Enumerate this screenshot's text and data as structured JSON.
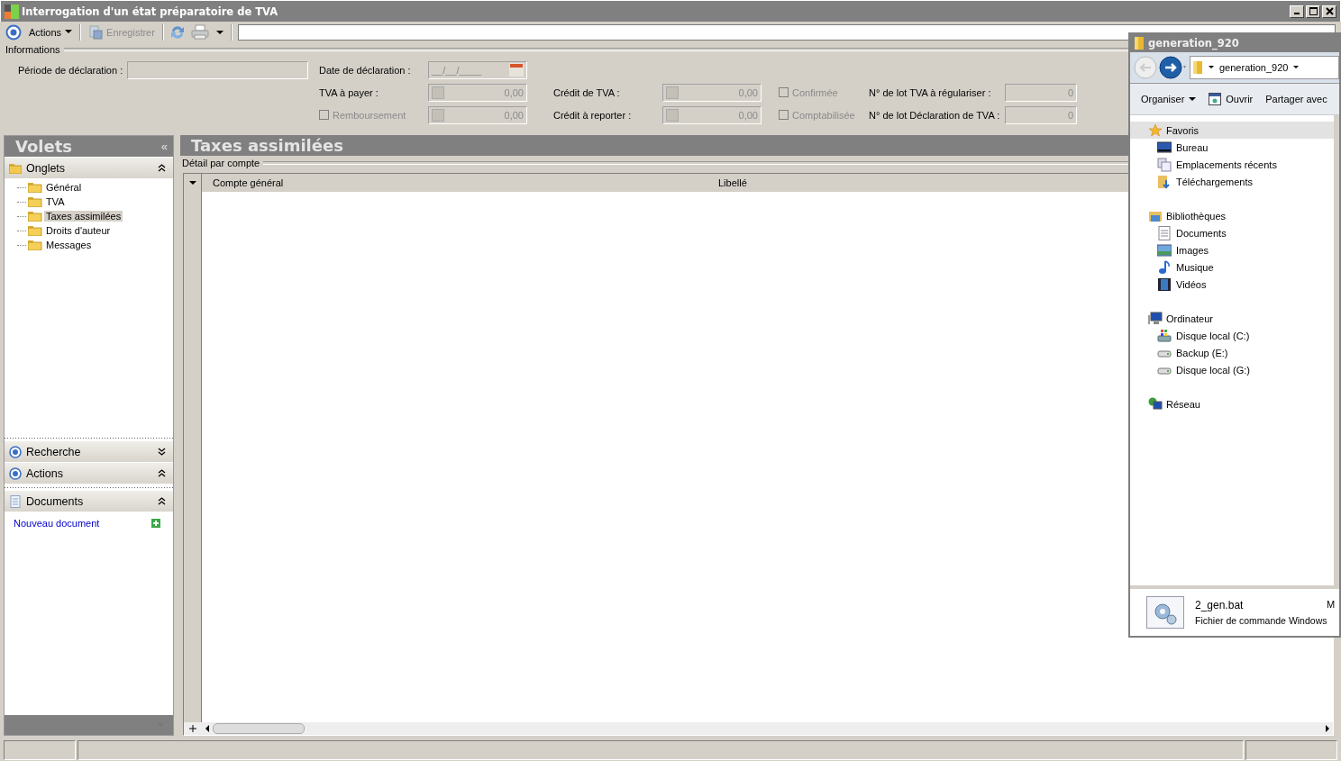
{
  "window": {
    "title": "Interrogation d'un état préparatoire de TVA"
  },
  "toolbar": {
    "actions": "Actions",
    "save": {
      "label": "Enregistrer",
      "disabled": true
    }
  },
  "informations": {
    "legend": "Informations",
    "periode": {
      "label": "Période de déclaration :"
    },
    "date": {
      "label": "Date de déclaration :",
      "value": "__/__/____"
    },
    "tva_a_payer": {
      "label": "TVA à payer :",
      "value": "0,00"
    },
    "remboursement": {
      "label": "Remboursement",
      "checked": false,
      "disabled": true,
      "value": "0,00"
    },
    "credit_tva": {
      "label": "Crédit de TVA :",
      "value": "0,00"
    },
    "credit_reporter": {
      "label": "Crédit à reporter :",
      "value": "0,00"
    },
    "confirmee": {
      "label": "Confirmée",
      "checked": false,
      "disabled": true
    },
    "comptabilisee": {
      "label": "Comptabilisée",
      "checked": false,
      "disabled": true
    },
    "lot_tva": {
      "label": "N° de lot TVA à régulariser :",
      "value": "0"
    },
    "lot_declaration": {
      "label": "N° de lot Déclaration de TVA :",
      "value": "0"
    }
  },
  "volets": {
    "title": "Volets",
    "collapse": "«",
    "onglets": {
      "label": "Onglets",
      "expanded": true,
      "items": [
        {
          "label": "Général",
          "selected": false
        },
        {
          "label": "TVA",
          "selected": false
        },
        {
          "label": "Taxes assimilées",
          "selected": true
        },
        {
          "label": "Droits d'auteur",
          "selected": false
        },
        {
          "label": "Messages",
          "selected": false
        }
      ]
    },
    "recherche": {
      "label": "Recherche",
      "expanded": false
    },
    "actions": {
      "label": "Actions",
      "expanded": true
    },
    "documents": {
      "label": "Documents",
      "expanded": true,
      "link": "Nouveau document"
    }
  },
  "main": {
    "title": "Taxes assimilées",
    "group": "Détail par compte",
    "columns": [
      "Compte général",
      "Libellé"
    ]
  },
  "explorer": {
    "title": "generation_920",
    "breadcrumb": "generation_920",
    "commands": [
      "Organiser",
      "Ouvrir",
      "Partager avec"
    ],
    "groups": [
      {
        "label": "Favoris",
        "selected": true,
        "children": [
          {
            "label": "Bureau"
          },
          {
            "label": "Emplacements récents"
          },
          {
            "label": "Téléchargements"
          }
        ]
      },
      {
        "label": "Bibliothèques",
        "selected": false,
        "children": [
          {
            "label": "Documents"
          },
          {
            "label": "Images"
          },
          {
            "label": "Musique"
          },
          {
            "label": "Vidéos"
          }
        ]
      },
      {
        "label": "Ordinateur",
        "selected": false,
        "children": [
          {
            "label": "Disque local (C:)"
          },
          {
            "label": "Backup (E:)"
          },
          {
            "label": "Disque local (G:)"
          }
        ]
      },
      {
        "label": "Réseau",
        "selected": false
      }
    ],
    "details": {
      "name": "2_gen.bat",
      "type": "Fichier de commande Windows",
      "column_3": "M"
    }
  }
}
